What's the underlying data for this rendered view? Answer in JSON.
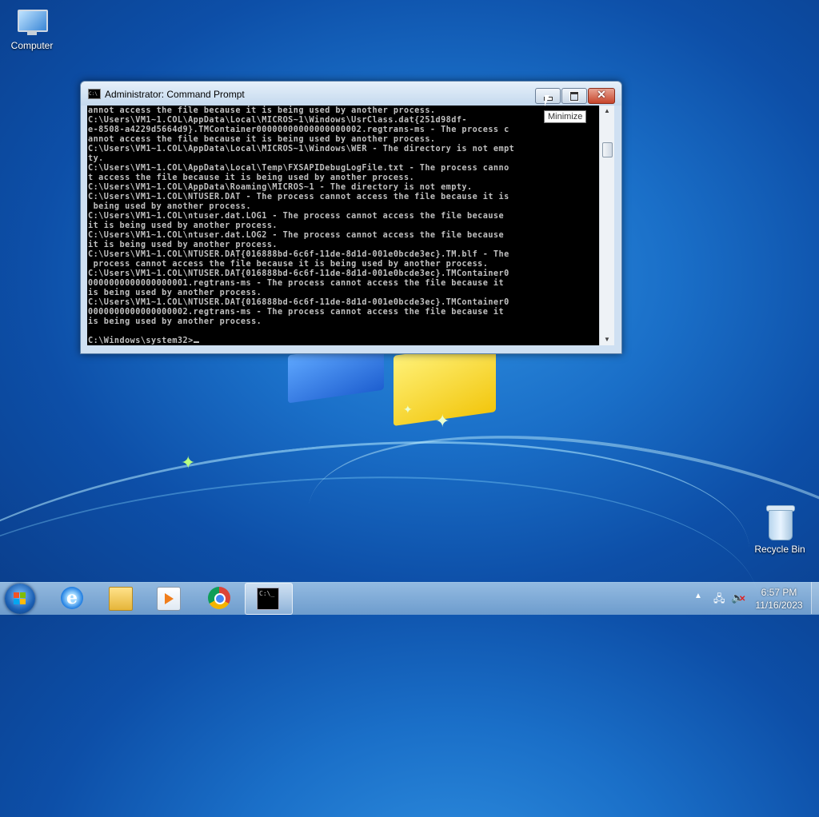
{
  "desktop": {
    "icons": [
      {
        "label": "Computer",
        "icon": "computer-icon"
      },
      {
        "label": "Recycle Bin",
        "icon": "recycle-bin-icon"
      }
    ]
  },
  "window": {
    "title": "Administrator: Command Prompt",
    "tooltip": "Minimize",
    "console_lines": [
      "annot access the file because it is being used by another process.",
      "C:\\Users\\VM1~1.COL\\AppData\\Local\\MICROS~1\\Windows\\UsrClass.dat{251d98df-",
      "e-8508-a4229d5664d9}.TMContainer00000000000000000002.regtrans-ms - The process c",
      "annot access the file because it is being used by another process.",
      "C:\\Users\\VM1~1.COL\\AppData\\Local\\MICROS~1\\Windows\\WER - The directory is not empt",
      "ty.",
      "C:\\Users\\VM1~1.COL\\AppData\\Local\\Temp\\FXSAPIDebugLogFile.txt - The process canno",
      "t access the file because it is being used by another process.",
      "C:\\Users\\VM1~1.COL\\AppData\\Roaming\\MICROS~1 - The directory is not empty.",
      "C:\\Users\\VM1~1.COL\\NTUSER.DAT - The process cannot access the file because it is",
      " being used by another process.",
      "C:\\Users\\VM1~1.COL\\ntuser.dat.LOG1 - The process cannot access the file because",
      "it is being used by another process.",
      "C:\\Users\\VM1~1.COL\\ntuser.dat.LOG2 - The process cannot access the file because",
      "it is being used by another process.",
      "C:\\Users\\VM1~1.COL\\NTUSER.DAT{016888bd-6c6f-11de-8d1d-001e0bcde3ec}.TM.blf - The",
      " process cannot access the file because it is being used by another process.",
      "C:\\Users\\VM1~1.COL\\NTUSER.DAT{016888bd-6c6f-11de-8d1d-001e0bcde3ec}.TMContainer0",
      "0000000000000000001.regtrans-ms - The process cannot access the file because it",
      "is being used by another process.",
      "C:\\Users\\VM1~1.COL\\NTUSER.DAT{016888bd-6c6f-11de-8d1d-001e0bcde3ec}.TMContainer0",
      "0000000000000000002.regtrans-ms - The process cannot access the file because it",
      "is being used by another process.",
      "",
      "C:\\Windows\\system32>"
    ]
  },
  "taskbar": {
    "apps": [
      {
        "name": "internet-explorer",
        "icon": "ie-icon"
      },
      {
        "name": "file-explorer",
        "icon": "folder-icon"
      },
      {
        "name": "windows-media-player",
        "icon": "media-player-icon"
      },
      {
        "name": "google-chrome",
        "icon": "chrome-icon"
      },
      {
        "name": "command-prompt",
        "icon": "cmd-icon",
        "active": true
      }
    ],
    "ie_glyph": "e",
    "cmd_glyph": "C:\\_"
  },
  "clock": {
    "time": "6:57 PM",
    "date": "11/16/2023"
  },
  "colors": {
    "console_bg": "#000000",
    "console_fg": "#c0c0c0",
    "close_red": "#c7452b"
  }
}
